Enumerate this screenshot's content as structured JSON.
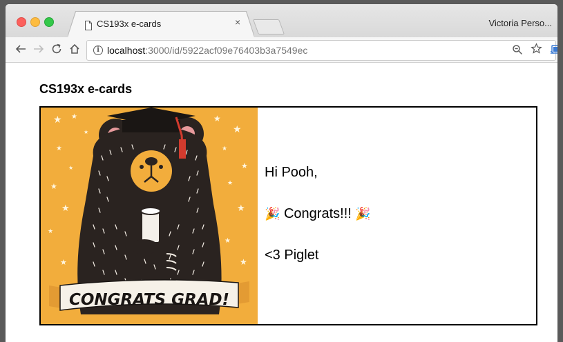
{
  "browser": {
    "tab": {
      "title": "CS193x e-cards",
      "close": "×"
    },
    "profile": "Victoria Perso...",
    "url": {
      "host": "localhost",
      "path": ":3000/id/5922acf09e76403b3a7549ec"
    }
  },
  "page": {
    "heading": "CS193x e-cards",
    "card": {
      "image_caption": "CONGRATS GRAD!",
      "greeting": "Hi Pooh,",
      "message": "Congrats!!!",
      "emoji": "🎉",
      "signature": "<3 Piglet"
    }
  },
  "colors": {
    "card_background": "#f2ad3c",
    "bear_fur": "#2a2320",
    "tassel": "#d23b2e"
  }
}
